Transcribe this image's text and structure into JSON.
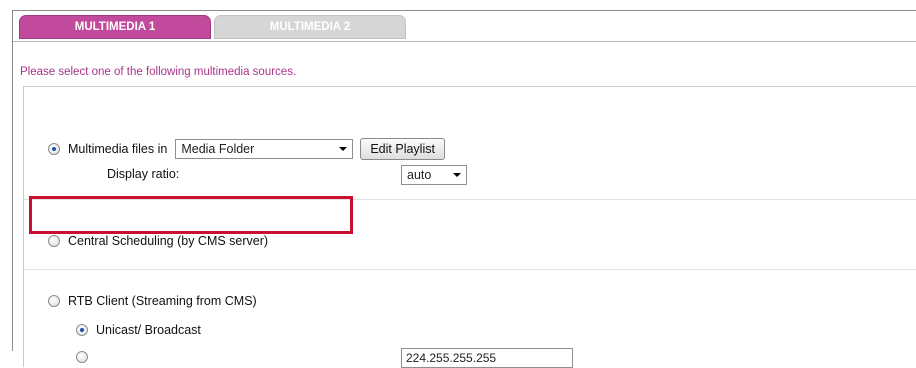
{
  "tabs": [
    {
      "label": "MULTIMEDIA 1",
      "active": true
    },
    {
      "label": "MULTIMEDIA 2",
      "active": false
    }
  ],
  "instruction": "Please select one of the following multimedia sources.",
  "options": {
    "multimedia_files": {
      "label": "Multimedia files in",
      "selected": true,
      "folder_select_value": "Media Folder",
      "edit_playlist_label": "Edit Playlist",
      "display_ratio_label": "Display ratio:",
      "display_ratio_value": "auto"
    },
    "central_scheduling": {
      "label": "Central Scheduling (by CMS server)",
      "selected": false
    },
    "rtb_client": {
      "label": "RTB Client (Streaming from CMS)",
      "selected": false,
      "sub_options": [
        {
          "label": "Unicast/ Broadcast",
          "selected": true
        },
        {
          "label": "",
          "selected": false
        }
      ],
      "address_value": "224.255.255.255"
    }
  },
  "colors": {
    "active_tab": "#c14a9c",
    "inactive_tab": "#d6d6d6",
    "instruction_text": "#a9338a",
    "highlight_border": "#c8102e"
  }
}
